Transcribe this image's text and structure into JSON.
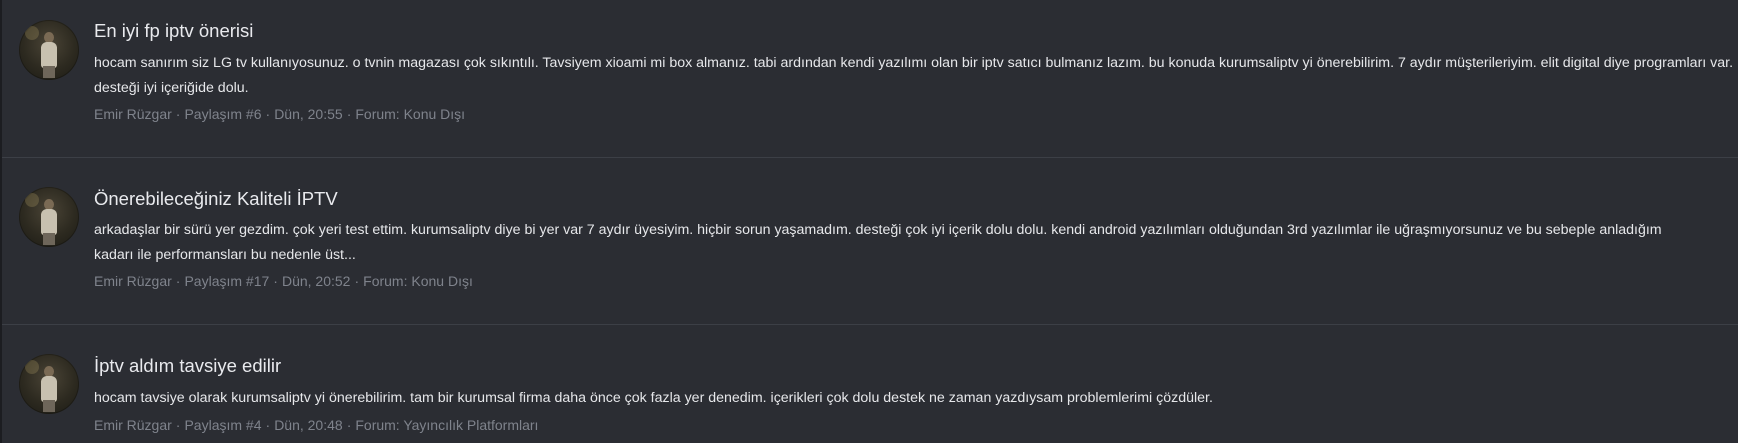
{
  "posts": [
    {
      "title": "En iyi fp iptv önerisi",
      "body": "hocam sanırım siz LG tv kullanıyosunuz. o tvnin magazası çok sıkıntılı. Tavsiyem xioami mi box almanız. tabi ardından kendi yazılımı olan bir iptv satıcı bulmanız lazım. bu konuda kurumsaliptv yi önerebilirim. 7 aydır müşterileriyim. elit digital diye programları var. desteği iyi içeriğide dolu.",
      "author": "Emir Rüzgar",
      "post_number": "Paylaşım #6",
      "time": "Dün, 20:55",
      "forum": "Forum: Konu Dışı"
    },
    {
      "title": "Önerebileceğiniz Kaliteli İPTV",
      "body_line1": "arkadaşlar bir sürü yer gezdim. çok yeri test ettim. kurumsaliptv diye bi yer var 7 aydır üyesiyim. hiçbir sorun yaşamadım. desteği çok iyi içerik dolu dolu. kendi android yazılımları olduğundan 3rd yazılımlar ile uğraşmıyorsunuz ve bu sebeple anladığım",
      "body_line2": "kadarı ile performansları bu nedenle üst...",
      "author": "Emir Rüzgar",
      "post_number": "Paylaşım #17",
      "time": "Dün, 20:52",
      "forum": "Forum: Konu Dışı"
    },
    {
      "title": "İptv aldım tavsiye edilir",
      "body": "hocam tavsiye olarak kurumsaliptv yi önerebilirim. tam bir kurumsal firma daha önce çok fazla yer denedim. içerikleri çok dolu destek ne zaman yazdıysam problemlerimi çözdüler.",
      "author": "Emir Rüzgar",
      "post_number": "Paylaşım #4",
      "time": "Dün, 20:48",
      "forum": "Forum: Yayıncılık Platformları"
    }
  ],
  "meta_separator": "·"
}
